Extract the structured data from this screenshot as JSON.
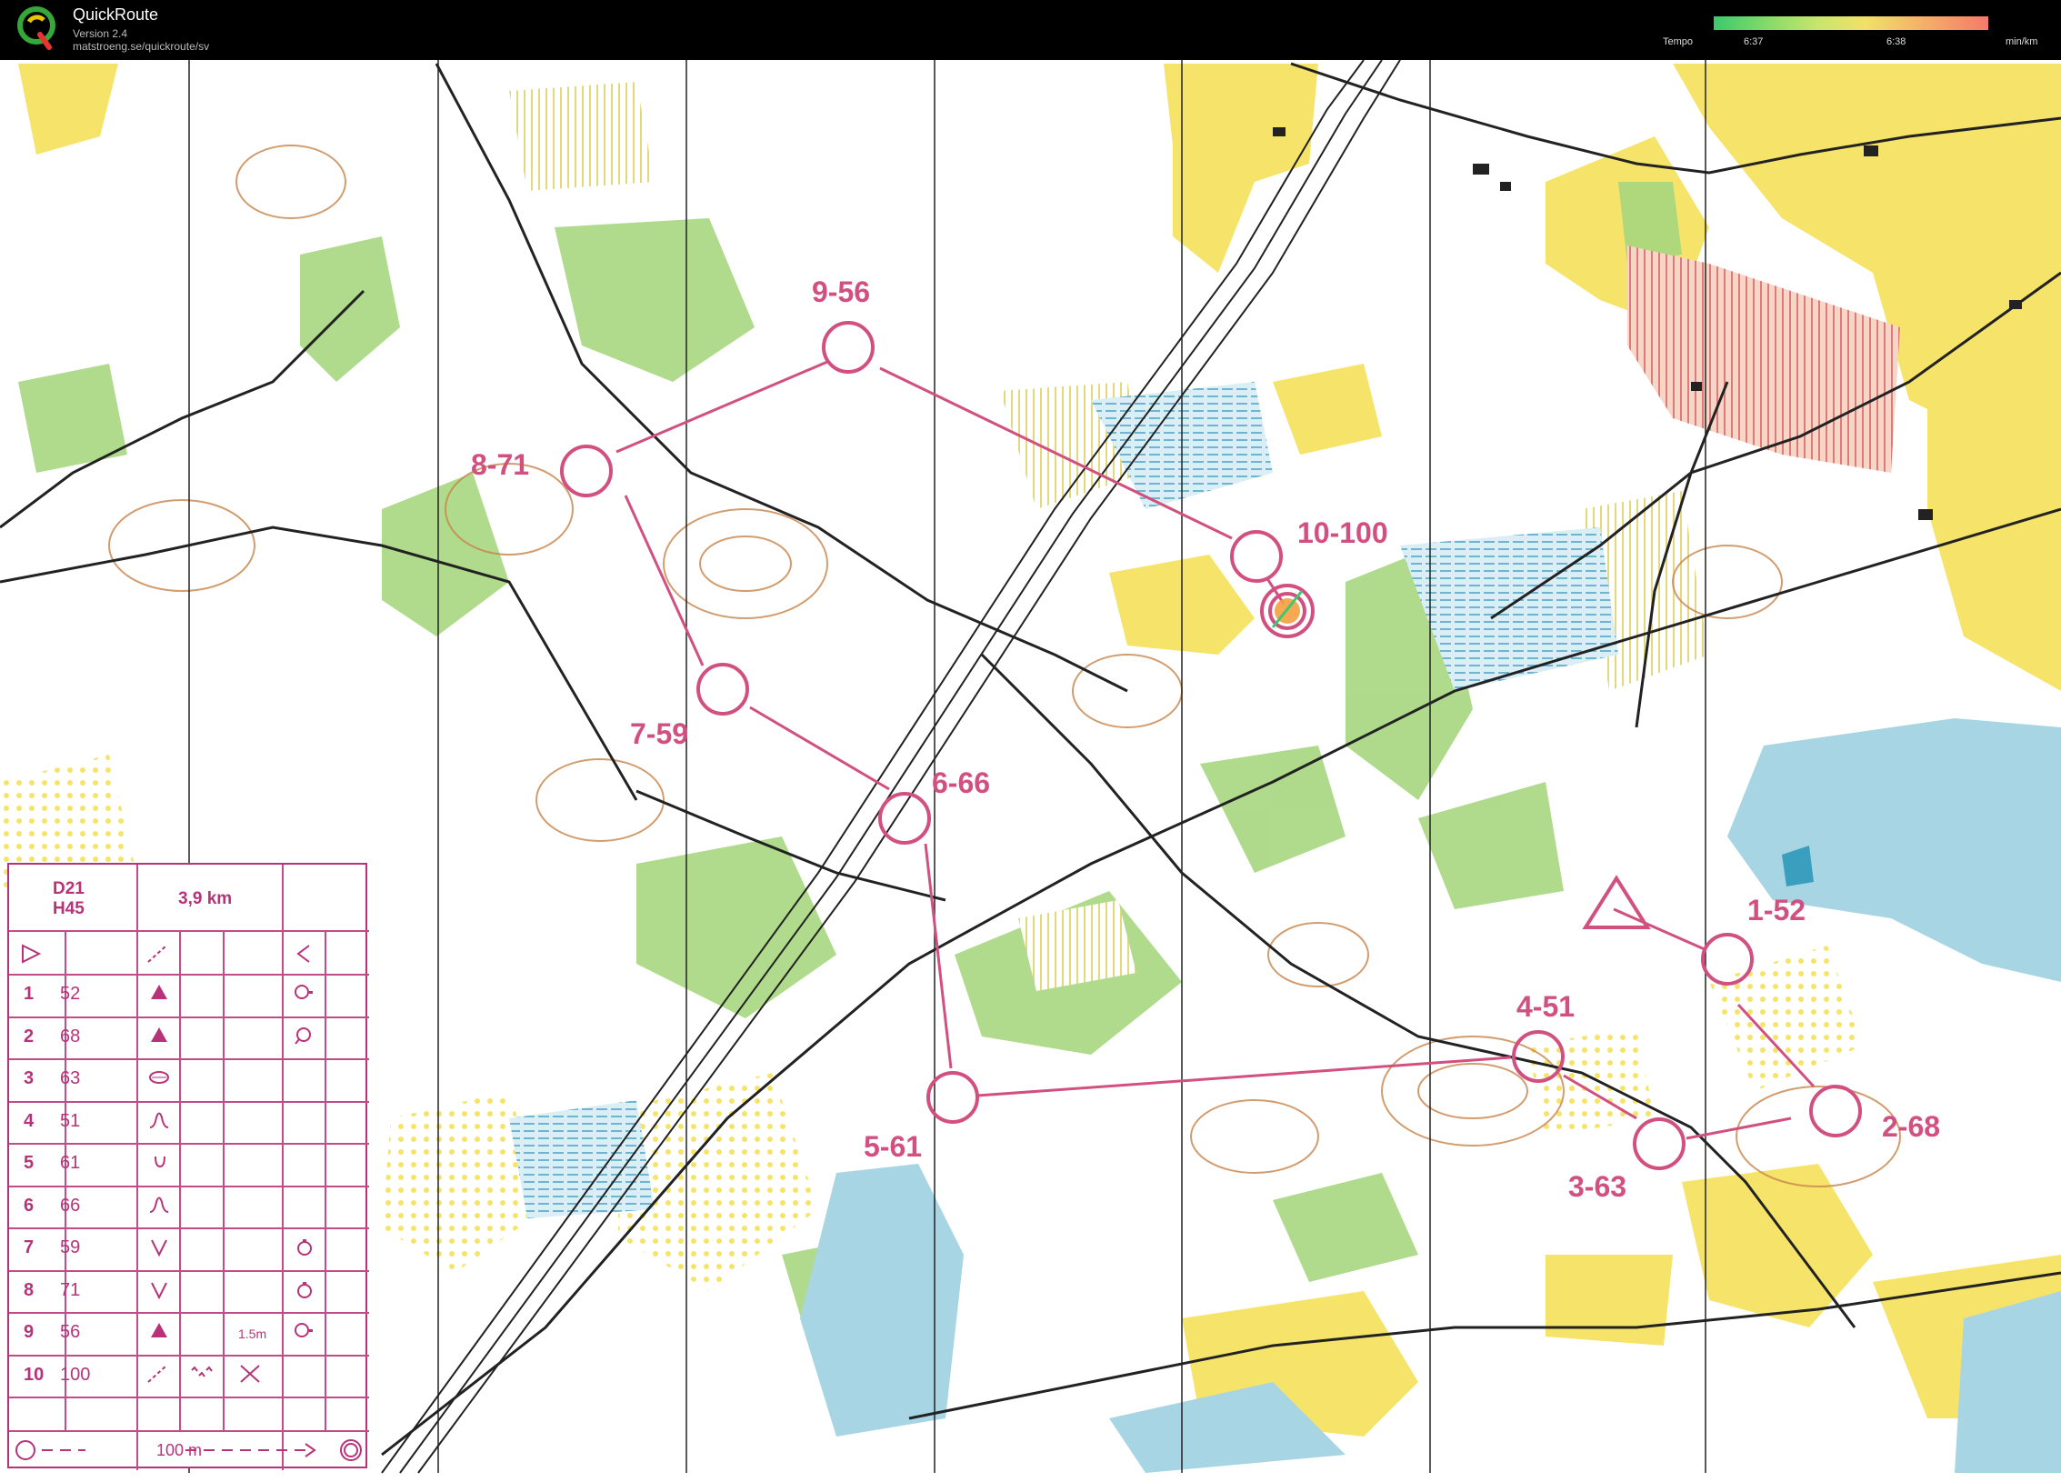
{
  "app": {
    "title": "QuickRoute",
    "version": "Version 2.4",
    "url": "matstroeng.se/quickroute/sv"
  },
  "tempo": {
    "label": "Tempo",
    "tick_low": "6:37",
    "tick_high": "6:38",
    "unit": "min/km"
  },
  "course": {
    "classes": [
      "D21",
      "H45"
    ],
    "length": "3,9 km",
    "controls": [
      {
        "number": "1",
        "code": "52",
        "label": "1-52"
      },
      {
        "number": "2",
        "code": "68",
        "label": "2-68"
      },
      {
        "number": "3",
        "code": "63",
        "label": "3-63"
      },
      {
        "number": "4",
        "code": "51",
        "label": "4-51"
      },
      {
        "number": "5",
        "code": "61",
        "label": "5-61"
      },
      {
        "number": "6",
        "code": "66",
        "label": "6-66"
      },
      {
        "number": "7",
        "code": "59",
        "label": "7-59"
      },
      {
        "number": "8",
        "code": "71",
        "label": "8-71"
      },
      {
        "number": "9",
        "code": "56",
        "label": "9-56"
      },
      {
        "number": "10",
        "code": "100",
        "label": "10-100"
      }
    ],
    "height_note": "1.5m",
    "finish_distance": "100 m"
  },
  "colors": {
    "course": "#d2507f",
    "forest": "#ffffff",
    "open": "#f6e46a",
    "green": "#9fd17a",
    "water": "#a8d5e3",
    "contour": "#c7844a"
  }
}
